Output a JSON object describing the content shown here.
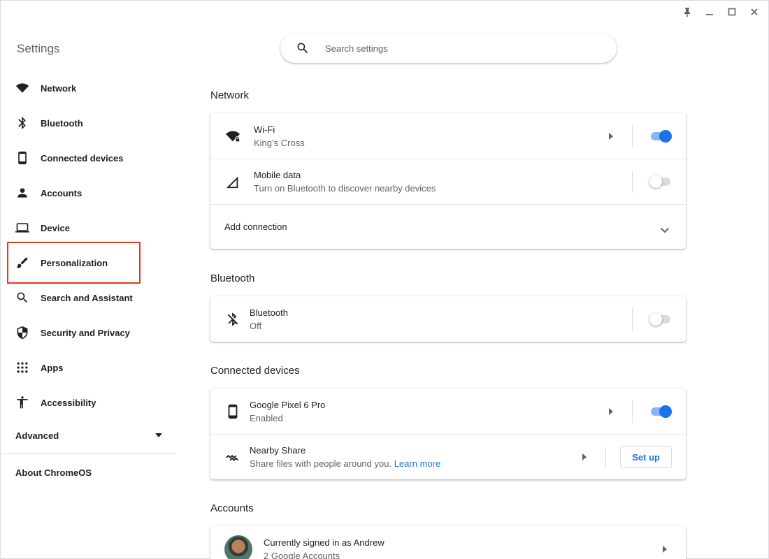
{
  "window": {
    "controls": [
      "pin-icon",
      "minimize-icon",
      "maximize-icon",
      "close-icon"
    ]
  },
  "app_title": "Settings",
  "search": {
    "placeholder": "Search settings"
  },
  "sidebar": {
    "items": [
      {
        "label": "Network",
        "icon": "wifi-icon"
      },
      {
        "label": "Bluetooth",
        "icon": "bluetooth-icon"
      },
      {
        "label": "Connected devices",
        "icon": "phone-icon"
      },
      {
        "label": "Accounts",
        "icon": "person-icon"
      },
      {
        "label": "Device",
        "icon": "laptop-icon"
      },
      {
        "label": "Personalization",
        "icon": "brush-icon",
        "highlighted": true
      },
      {
        "label": "Search and Assistant",
        "icon": "search-icon"
      },
      {
        "label": "Security and Privacy",
        "icon": "shield-icon"
      },
      {
        "label": "Apps",
        "icon": "apps-grid-icon"
      },
      {
        "label": "Accessibility",
        "icon": "accessibility-icon"
      }
    ],
    "advanced_label": "Advanced",
    "about_label": "About ChromeOS"
  },
  "sections": {
    "network": {
      "title": "Network",
      "wifi": {
        "label": "Wi-Fi",
        "sub": "King’s Cross",
        "toggle_on": true
      },
      "mobile": {
        "label": "Mobile data",
        "sub": "Turn on Bluetooth to discover nearby devices",
        "toggle_on": false
      },
      "add_connection": "Add connection"
    },
    "bluetooth": {
      "title": "Bluetooth",
      "bt": {
        "label": "Bluetooth",
        "sub": "Off",
        "toggle_on": false
      }
    },
    "connected_devices": {
      "title": "Connected devices",
      "phone": {
        "label": "Google Pixel 6 Pro",
        "sub": "Enabled",
        "toggle_on": true
      },
      "nearby": {
        "label": "Nearby Share",
        "sub": "Share files with people around you.",
        "link": "Learn more",
        "button": "Set up"
      }
    },
    "accounts": {
      "title": "Accounts",
      "signed_in": {
        "label": "Currently signed in as Andrew",
        "sub": "2 Google Accounts"
      }
    }
  },
  "colors": {
    "accent": "#1a73e8",
    "highlight_box": "#e8371e"
  }
}
